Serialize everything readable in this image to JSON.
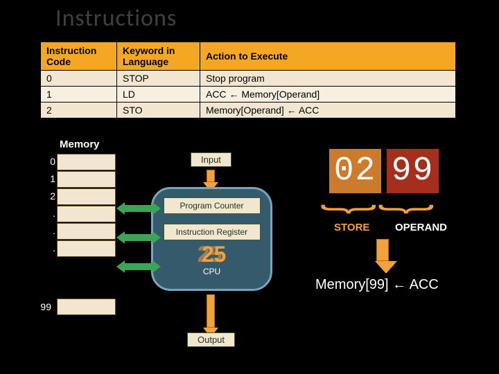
{
  "title": "Instructions",
  "table": {
    "headers": [
      "Instruction Code",
      "Keyword in Language",
      "Action to Execute"
    ],
    "rows": [
      {
        "code": "0",
        "keyword": "STOP",
        "action": "Stop program"
      },
      {
        "code": "1",
        "keyword": "LD",
        "action": "ACC ← Memory[Operand]"
      },
      {
        "code": "2",
        "keyword": "STO",
        "action": "Memory[Operand] ← ACC"
      }
    ]
  },
  "memory": {
    "label": "Memory",
    "indices": [
      "0",
      "1",
      "2",
      ".",
      ".",
      ".",
      "99"
    ]
  },
  "cpu": {
    "input_label": "Input",
    "output_label": "Output",
    "pc_label": "Program Counter",
    "ir_label": "Instruction Register",
    "caption": "CPU",
    "wheel_back": "25",
    "wheel_front": "25"
  },
  "display": {
    "left": "02",
    "right": "99",
    "store_label": "STORE",
    "operand_label": "OPERAND"
  },
  "expression": "Memory[99] ← ACC"
}
